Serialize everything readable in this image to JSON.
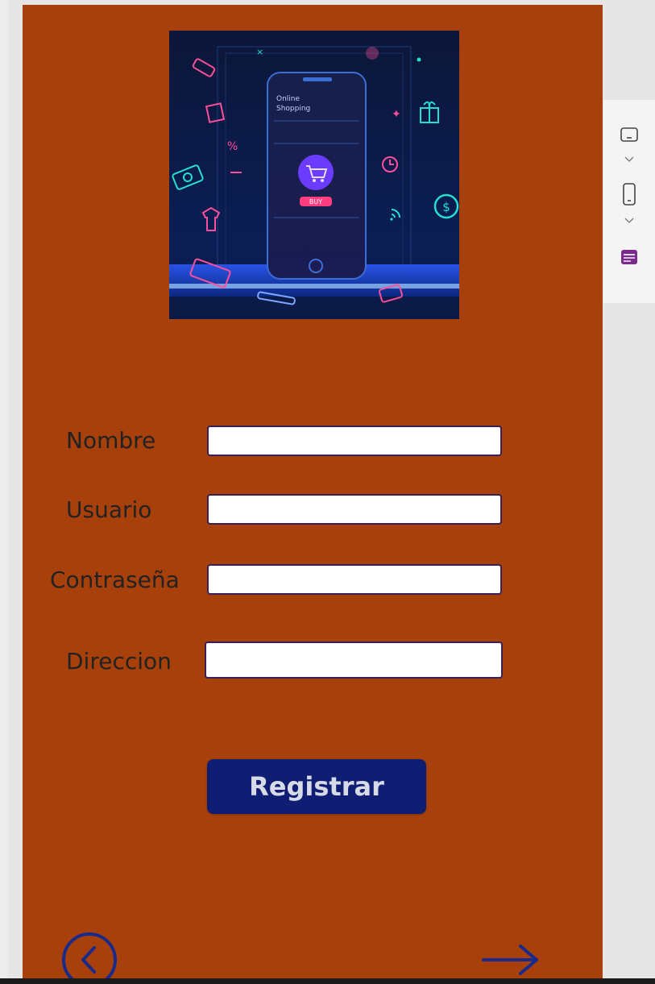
{
  "form": {
    "fields": [
      {
        "label": "Nombre",
        "value": ""
      },
      {
        "label": "Usuario",
        "value": ""
      },
      {
        "label": "Contraseña",
        "value": ""
      },
      {
        "label": "Direccion",
        "value": ""
      }
    ],
    "submit_label": "Registrar"
  },
  "hero": {
    "phone_text_line1": "Online",
    "phone_text_line2": "Shopping",
    "buy_label": "BUY"
  },
  "colors": {
    "screen_bg": "#a7400b",
    "button_bg": "#0f1d73",
    "nav_icon": "#1a2a8a",
    "side_accent": "#7a2c8c"
  },
  "icons": {
    "back": "chevron-left-circle-icon",
    "next": "arrow-right-icon",
    "tablet": "tablet-landscape-icon",
    "phone": "phone-portrait-icon",
    "layout": "layout-icon"
  }
}
